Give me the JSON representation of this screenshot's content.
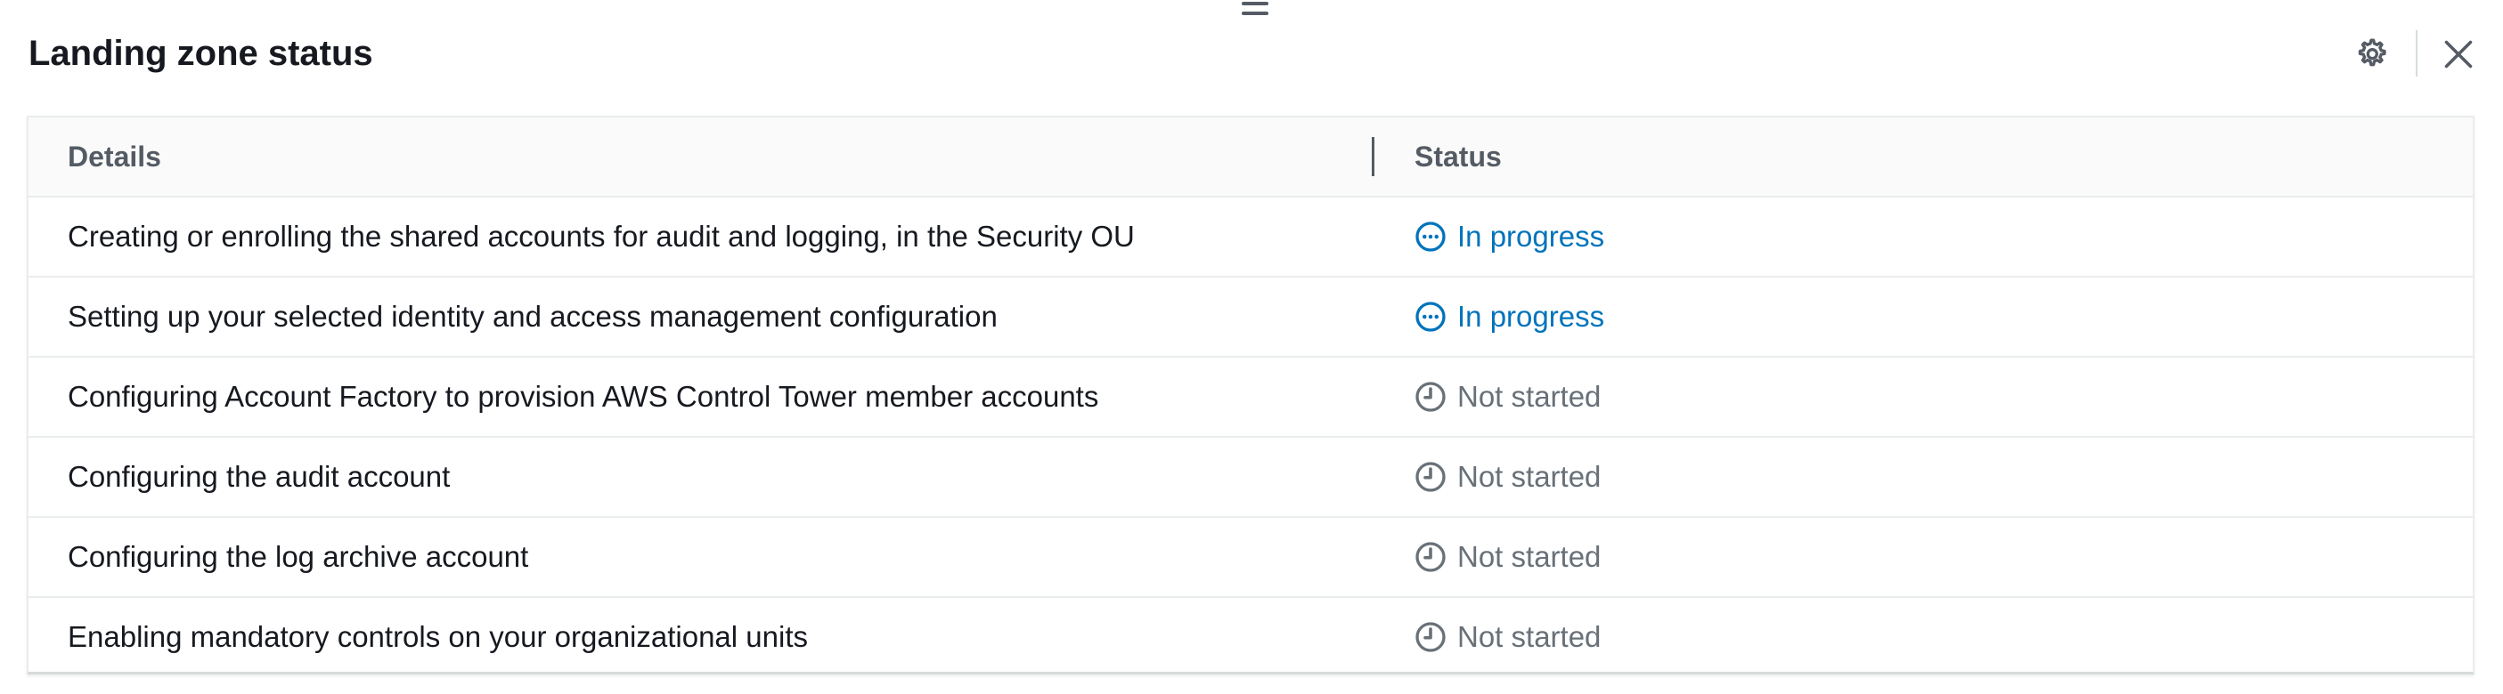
{
  "panel": {
    "title": "Landing zone status",
    "settings_icon": "gear-icon",
    "close_icon": "close-icon"
  },
  "colors": {
    "in_progress": "#0073bb",
    "not_started": "#687078",
    "header_text": "#545b64"
  },
  "table": {
    "columns": [
      "Details",
      "Status"
    ],
    "rows": [
      {
        "details": "Creating or enrolling the shared accounts for audit and logging, in the Security OU",
        "status": "In progress",
        "status_icon": "ellipsis-circle-icon"
      },
      {
        "details": "Setting up your selected identity and access management configuration",
        "status": "In progress",
        "status_icon": "ellipsis-circle-icon"
      },
      {
        "details": "Configuring Account Factory to provision AWS Control Tower member accounts",
        "status": "Not started",
        "status_icon": "clock-icon"
      },
      {
        "details": "Configuring the audit account",
        "status": "Not started",
        "status_icon": "clock-icon"
      },
      {
        "details": "Configuring the log archive account",
        "status": "Not started",
        "status_icon": "clock-icon"
      },
      {
        "details": "Enabling mandatory controls on your organizational units",
        "status": "Not started",
        "status_icon": "clock-icon"
      }
    ]
  }
}
